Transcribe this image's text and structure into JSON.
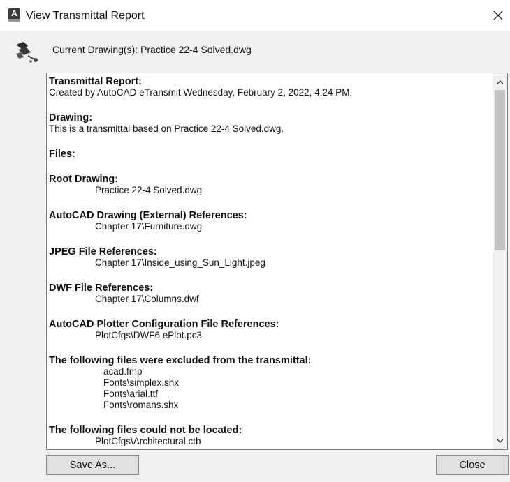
{
  "window": {
    "title": "View Transmittal Report",
    "app_icon_glyph": "A"
  },
  "header": {
    "current_drawing": "Current Drawing(s): Practice 22-4 Solved.dwg"
  },
  "report": {
    "sections": [
      {
        "heading": "Transmittal Report:",
        "lines": [
          "Created by AutoCAD eTransmit Wednesday, February 2, 2022, 4:24 PM."
        ],
        "indent": "none"
      },
      {
        "heading": "Drawing:",
        "lines": [
          "This is a transmittal based on Practice 22-4 Solved.dwg."
        ],
        "indent": "none"
      },
      {
        "heading": "Files:",
        "lines": [],
        "indent": "none"
      },
      {
        "heading": "Root Drawing:",
        "lines": [
          "Practice 22-4 Solved.dwg"
        ],
        "indent": "ind"
      },
      {
        "heading": "AutoCAD Drawing (External) References:",
        "lines": [
          "Chapter 17\\Furniture.dwg"
        ],
        "indent": "ind"
      },
      {
        "heading": "JPEG File References:",
        "lines": [
          "Chapter 17\\Inside_using_Sun_Light.jpeg"
        ],
        "indent": "ind"
      },
      {
        "heading": "DWF File References:",
        "lines": [
          "Chapter 17\\Columns.dwf"
        ],
        "indent": "ind"
      },
      {
        "heading": "AutoCAD Plotter Configuration File References:",
        "lines": [
          "PlotCfgs\\DWF6 ePlot.pc3"
        ],
        "indent": "ind"
      },
      {
        "heading": "The following files were excluded from the transmittal:",
        "lines": [
          "acad.fmp",
          "Fonts\\simplex.shx",
          "Fonts\\arial.ttf",
          "Fonts\\romans.shx"
        ],
        "indent": "ind2"
      },
      {
        "heading": "The following files could not be located:",
        "lines": [
          "PlotCfgs\\Architectural.ctb"
        ],
        "indent": "ind"
      }
    ]
  },
  "buttons": {
    "save_as": "Save As...",
    "close": "Close"
  },
  "icons": {
    "app": "autocad-app-icon",
    "close": "close-icon",
    "header": "etransmit-icon",
    "scroll_up": "chevron-up-icon",
    "scroll_down": "chevron-down-icon"
  }
}
